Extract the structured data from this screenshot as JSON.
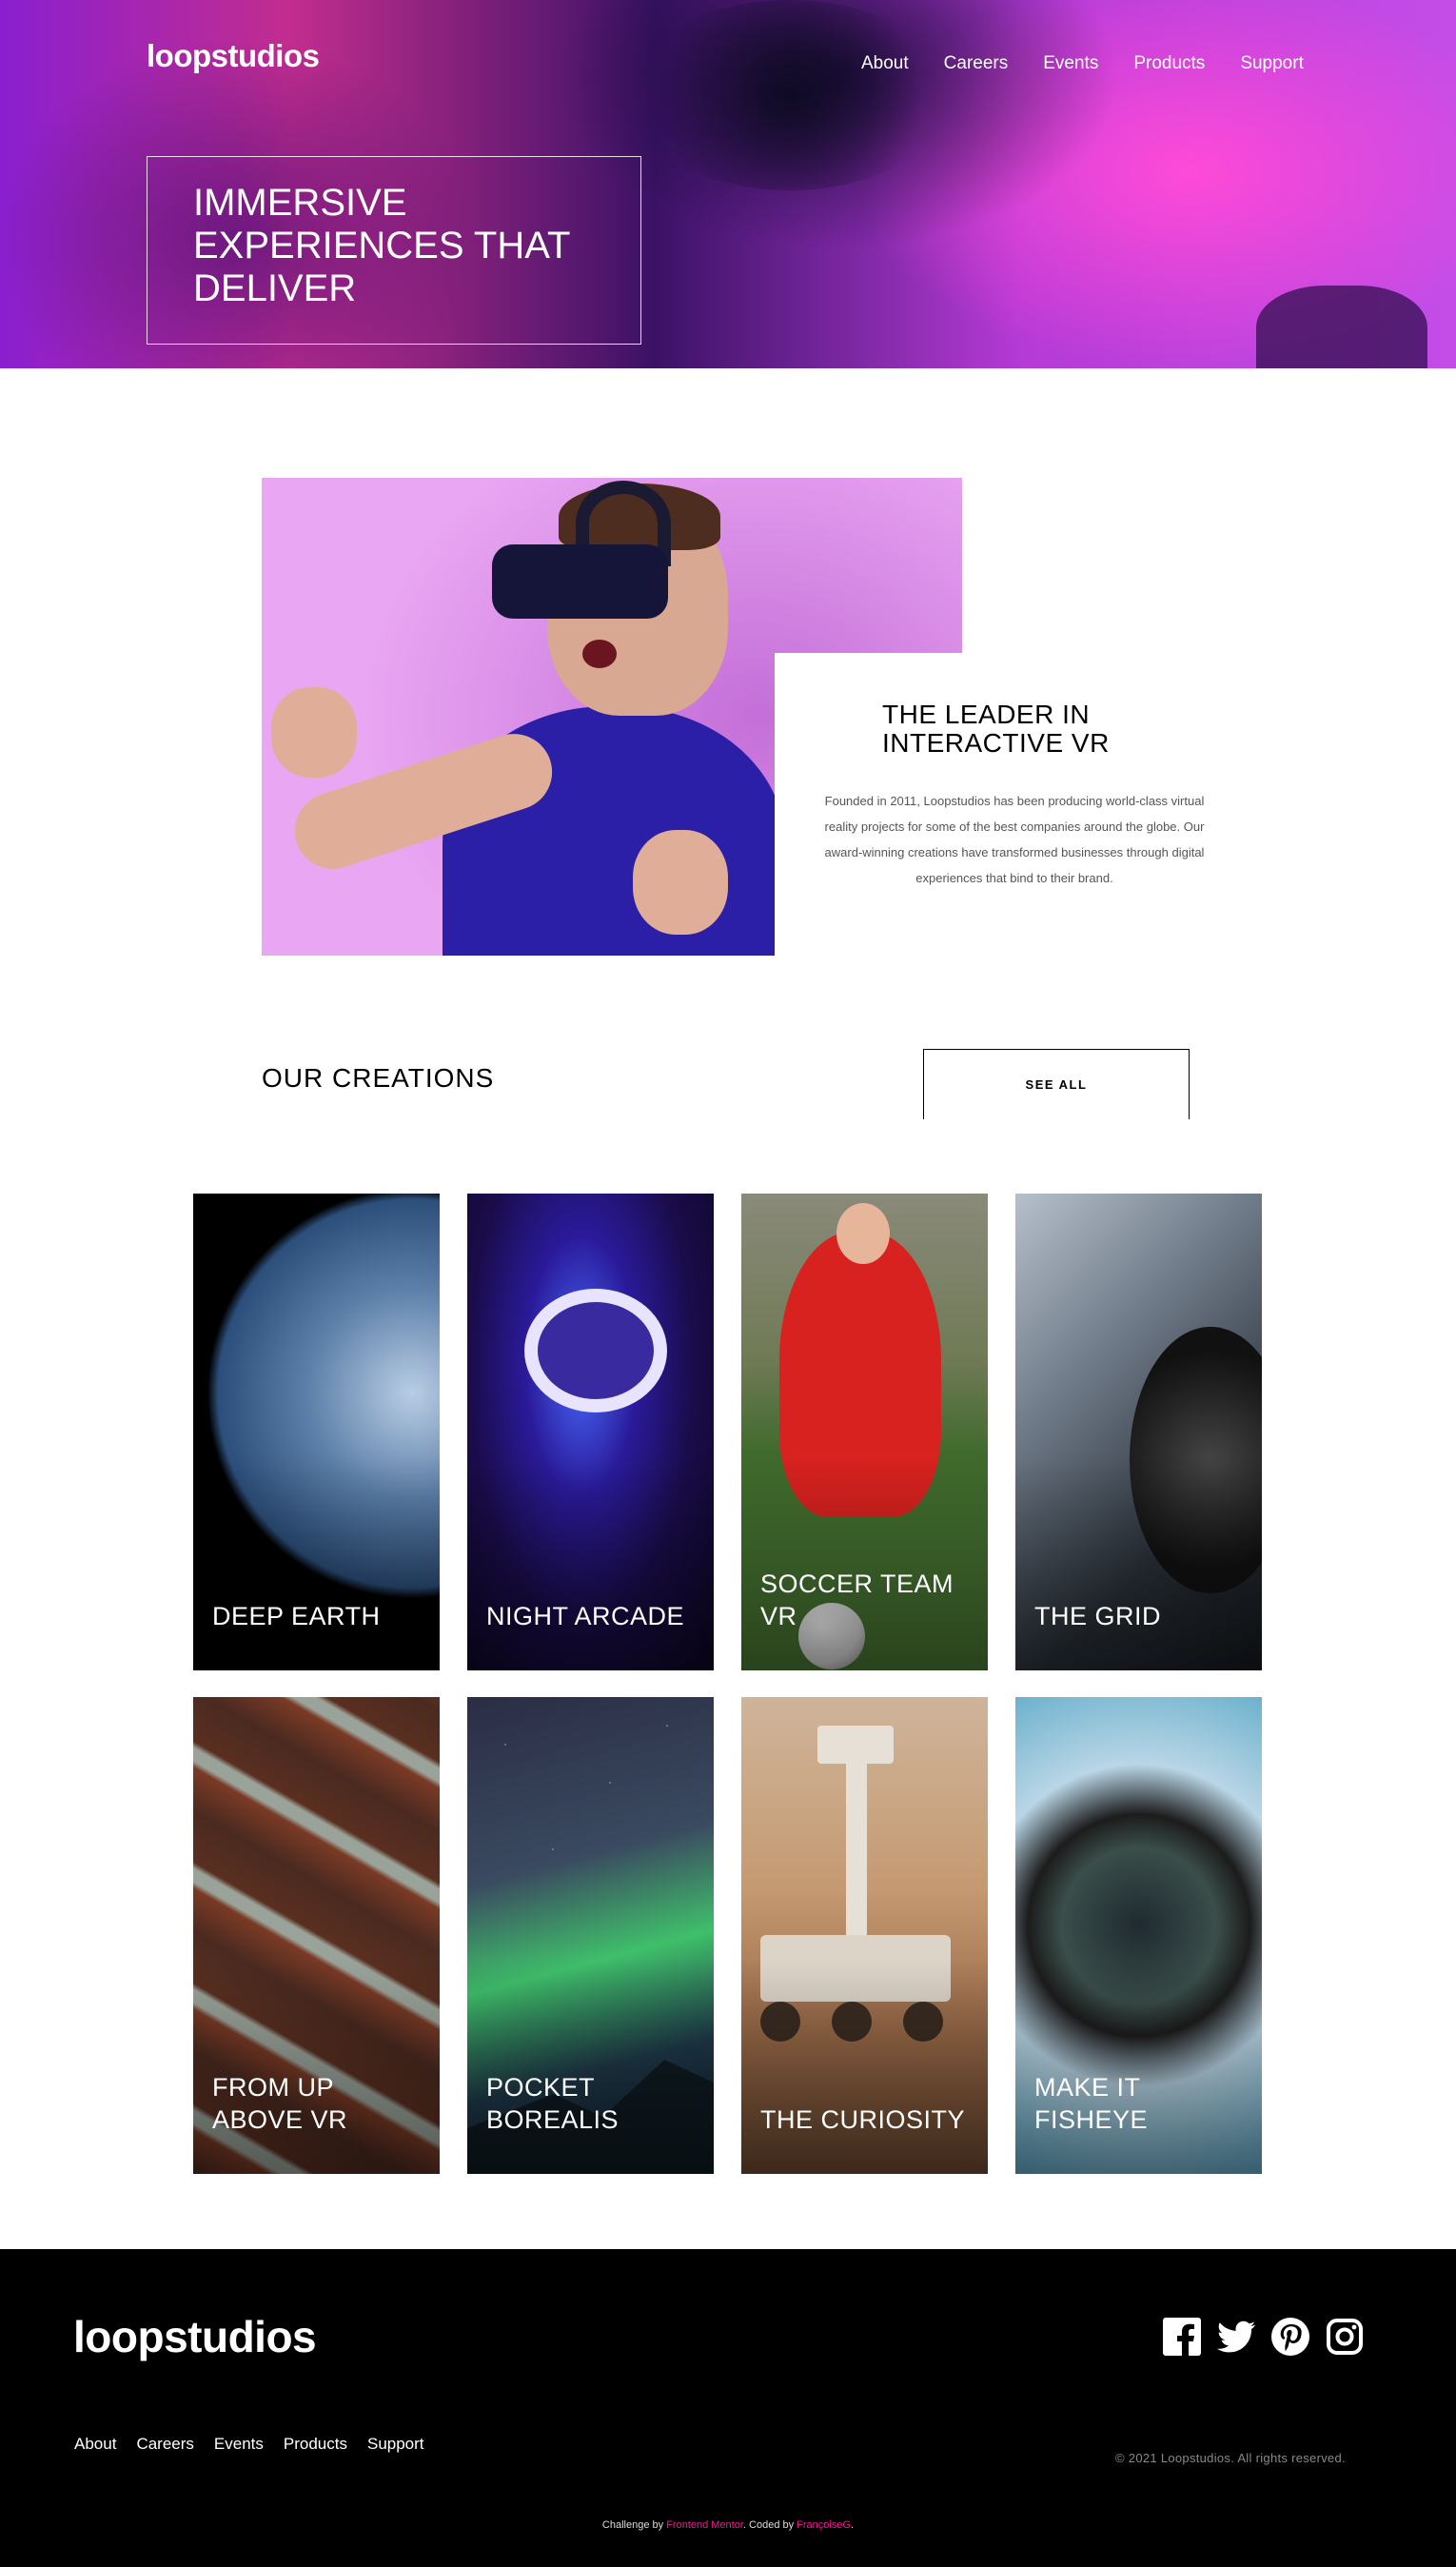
{
  "header": {
    "logo": "loopstudios",
    "nav": [
      "About",
      "Careers",
      "Events",
      "Products",
      "Support"
    ]
  },
  "hero": {
    "title": "IMMERSIVE EXPERIENCES THAT DELIVER"
  },
  "intro": {
    "heading": "THE LEADER IN INTERACTIVE VR",
    "body": "Founded in 2011, Loopstudios has been producing world-class virtual reality projects for some of the best companies around the globe. Our award-winning creations have transformed businesses through digital experiences that bind to their brand."
  },
  "creations": {
    "title": "OUR CREATIONS",
    "see_all": "SEE ALL",
    "items": [
      {
        "label": "DEEP EARTH"
      },
      {
        "label": "NIGHT ARCADE"
      },
      {
        "label": "SOCCER TEAM VR"
      },
      {
        "label": "THE GRID"
      },
      {
        "label": "FROM UP ABOVE VR"
      },
      {
        "label": "POCKET BOREALIS"
      },
      {
        "label": "THE CURIOSITY"
      },
      {
        "label": "MAKE IT FISHEYE"
      }
    ]
  },
  "footer": {
    "logo": "loopstudios",
    "nav": [
      "About",
      "Careers",
      "Events",
      "Products",
      "Support"
    ],
    "social_icons": [
      "facebook-icon",
      "twitter-icon",
      "pinterest-icon",
      "instagram-icon"
    ],
    "copyright": "© 2021 Loopstudios. All rights reserved.",
    "attribution": {
      "prefix": "Challenge by",
      "challenge_link": "Frontend Mentor",
      "middle": ". Coded by",
      "coder_link": "FrançoiseG",
      "suffix": "."
    }
  },
  "colors": {
    "accent": "#e91e8c",
    "footer_bg": "#000000"
  }
}
